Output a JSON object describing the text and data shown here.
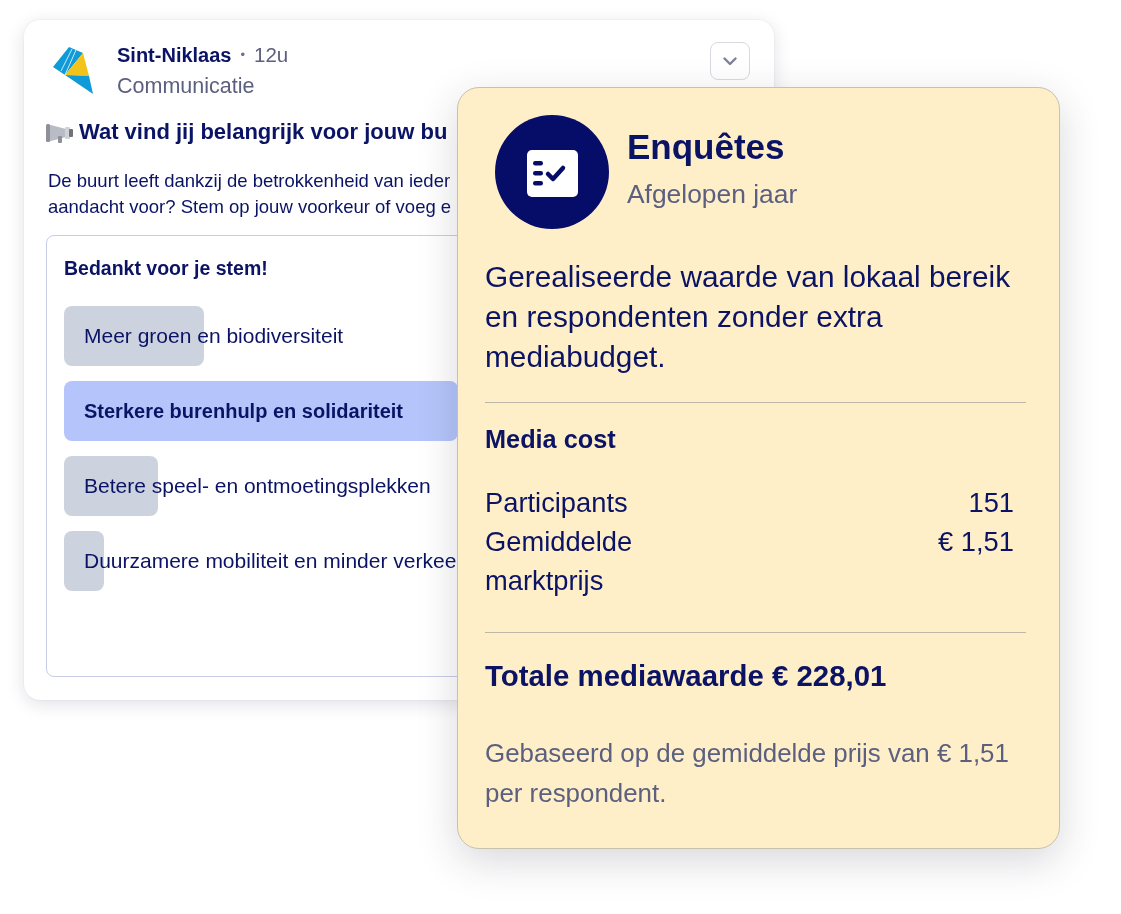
{
  "post": {
    "author": "Sint-Niklaas",
    "separator": "•",
    "time": "12u",
    "category": "Communicatie",
    "title": "Wat vind jij belangrijk voor jouw bu",
    "body_lines": [
      "De buurt leeft dankzij de betrokkenheid van ieder",
      "aandacht voor? Stem op jouw voorkeur of voeg e"
    ],
    "poll": {
      "heading": "Bedankt voor je stem!",
      "options": [
        {
          "label": "Meer groen en biodiversiteit",
          "level": 0.21,
          "selected": false
        },
        {
          "label": "Sterkere burenhulp en solidariteit",
          "level": 0.59,
          "selected": true
        },
        {
          "label": "Betere speel- en ontmoetingsplekken",
          "level": 0.14,
          "selected": false
        },
        {
          "label": "Duurzamere mobiliteit en minder verkee",
          "level": 0.06,
          "selected": false
        }
      ]
    }
  },
  "stats_card": {
    "title": "Enquêtes",
    "subtitle": "Afgelopen jaar",
    "description": "Gerealiseerde waarde van lokaal bereik en respondenten zonder extra mediabudget.",
    "section_title": "Media cost",
    "rows": [
      {
        "label": "Participants",
        "value": "151"
      },
      {
        "label": "Gemiddelde marktprijs",
        "value": "€ 1,51"
      }
    ],
    "total": "Totale mediawaarde € 228,01",
    "footnote": "Gebaseerd op de gemiddelde prijs van € 1,51 per respondent."
  }
}
